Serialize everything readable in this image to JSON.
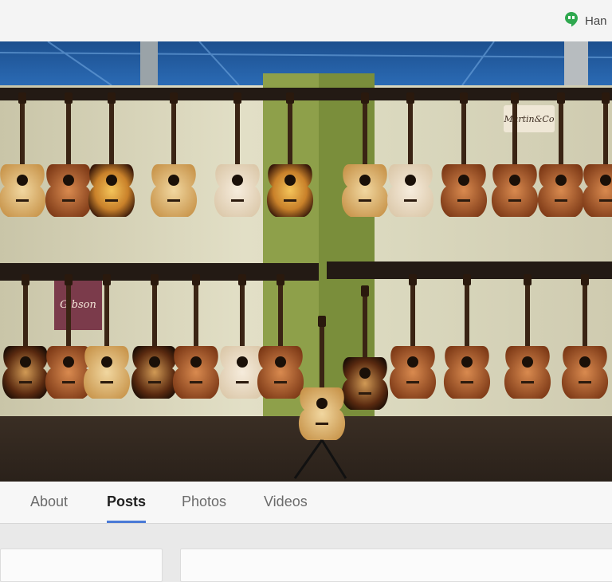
{
  "header": {
    "hangouts_label": "Han"
  },
  "tabs": [
    {
      "label": "About",
      "active": false
    },
    {
      "label": "Posts",
      "active": true
    },
    {
      "label": "Photos",
      "active": false
    },
    {
      "label": "Videos",
      "active": false
    }
  ],
  "colors": {
    "accent": "#4a7ad6",
    "hangouts_green": "#2fa84f"
  },
  "cover_photo": {
    "signs": [
      "Gibson",
      "Martin&Co"
    ]
  }
}
